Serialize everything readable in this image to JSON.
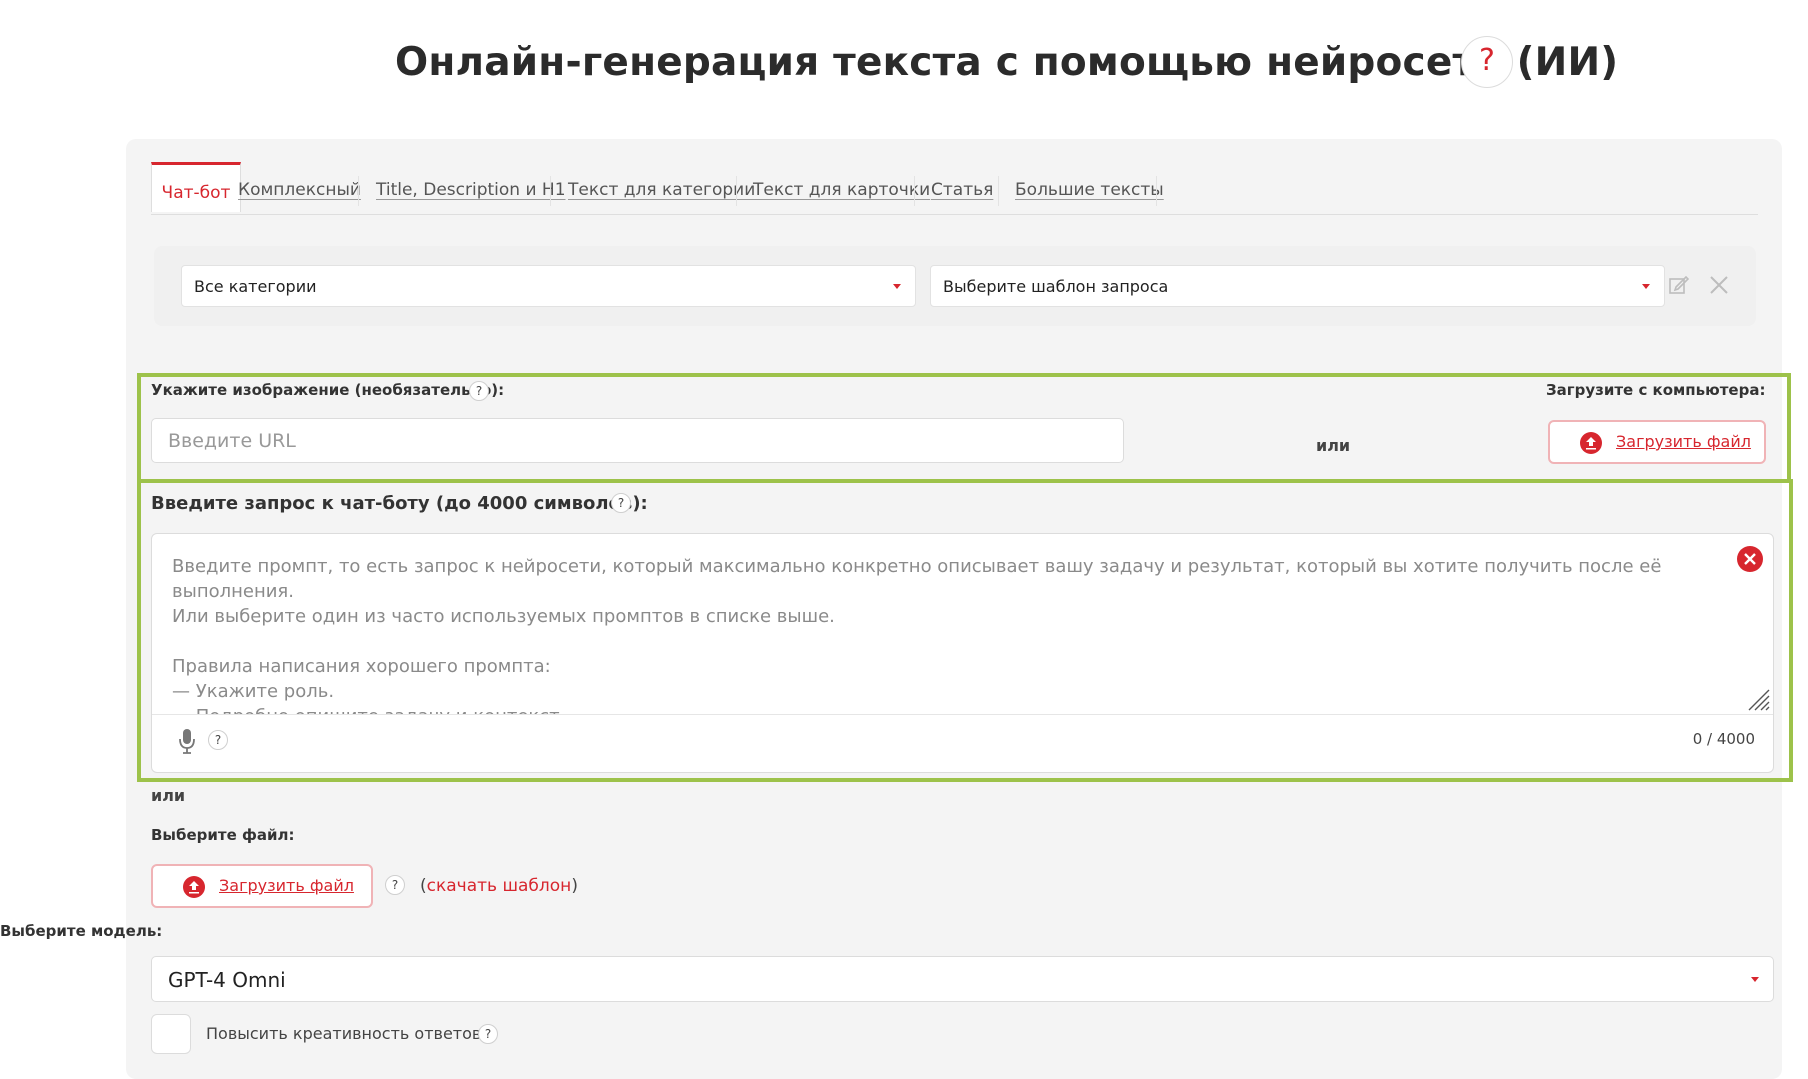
{
  "header": {
    "title": "Онлайн-генерация текста с помощью нейросети (ИИ)",
    "help": "?"
  },
  "tabs": [
    {
      "label": "Чат-бот"
    },
    {
      "label": "Комплексный"
    },
    {
      "label": "Title, Description и H1"
    },
    {
      "label": "Текст для категории"
    },
    {
      "label": "Текст для карточки"
    },
    {
      "label": "Статья"
    },
    {
      "label": "Большие тексты"
    }
  ],
  "filters": {
    "category": "Все категории",
    "template": "Выберите шаблон запроса"
  },
  "image": {
    "label": "Укажите изображение (необязательно):",
    "help": "?",
    "url_placeholder": "Введите URL",
    "or": "или",
    "upload_label": "Загрузите с компьютера:",
    "upload_button": "Загрузить файл"
  },
  "prompt": {
    "label": "Введите запрос к чат-боту (до 4000 символов):",
    "help": "?",
    "placeholder": "Введите промпт, то есть запрос к нейросети, который максимально конкретно описывает вашу задачу и результат, который вы хотите получить после её выполнения.\nИли выберите один из часто используемых промптов в списке выше.\n\nПравила написания хорошего промпта:\n— Укажите роль.\n— Подробно опишите задачу и контекст.\n— Обозначьте стиль.",
    "mic_help": "?",
    "counter": "0 / 4000"
  },
  "file": {
    "or": "или",
    "label": "Выберите файл:",
    "upload_button": "Загрузить файл",
    "help": "?",
    "template_open": "(",
    "template_link": "скачать шаблон",
    "template_close": ")"
  },
  "model": {
    "label": "Выберите модель:",
    "value": "GPT-4 Omni"
  },
  "creativity": {
    "label": "Повысить креативность ответов",
    "help": "?"
  },
  "colors": {
    "accent": "#d7262e",
    "highlight": "#9dc24a"
  }
}
